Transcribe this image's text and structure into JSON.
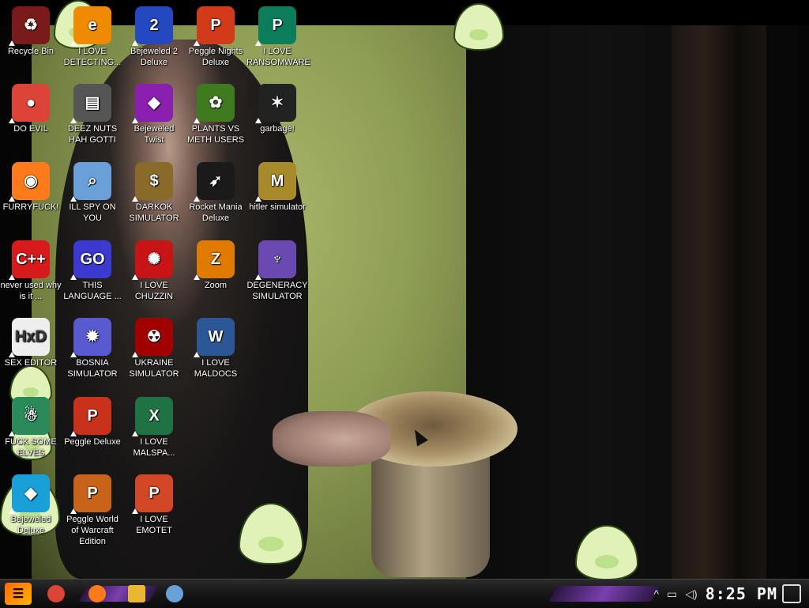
{
  "desktop": {
    "icons": [
      {
        "name": "recycle-bin-icon",
        "label": "Recycle Bin",
        "bg": "#7a1a1a",
        "glyph": "♻"
      },
      {
        "name": "i-love-detecting-icon",
        "label": "I LOVE DETECTING...",
        "bg": "#f08a00",
        "glyph": "e"
      },
      {
        "name": "bejeweled-2-deluxe-icon",
        "label": "Bejeweled 2 Deluxe",
        "bg": "#2448c0",
        "glyph": "2"
      },
      {
        "name": "peggle-nights-deluxe-icon",
        "label": "Peggle Nights Deluxe",
        "bg": "#d23a1a",
        "glyph": "P"
      },
      {
        "name": "i-love-ransomware-icon",
        "label": "I LOVE RANSOMWARE",
        "bg": "#0c7d5a",
        "glyph": "P"
      },
      {
        "name": "do-evil-icon",
        "label": "DO EVIL",
        "bg": "#db4437",
        "glyph": "●"
      },
      {
        "name": "deez-nuts-icon",
        "label": "DEEZ NUTS HAH GOTTI",
        "bg": "#555",
        "glyph": "▤"
      },
      {
        "name": "bejeweled-twist-icon",
        "label": "Bejeweled Twist",
        "bg": "#8a1fb0",
        "glyph": "◆"
      },
      {
        "name": "plants-vs-meth-users-icon",
        "label": "PLANTS VS METH USERS",
        "bg": "#3f7a1e",
        "glyph": "✿"
      },
      {
        "name": "garbage-icon",
        "label": "garbage!",
        "bg": "#222",
        "glyph": "✶"
      },
      {
        "name": "furryfuck-icon",
        "label": "FURRYFUCK!",
        "bg": "#ff7a1a",
        "glyph": "◉"
      },
      {
        "name": "ill-spy-on-you-icon",
        "label": "ILL SPY ON YOU",
        "bg": "#6aa0d8",
        "glyph": "⌕"
      },
      {
        "name": "darkok-simulator-icon",
        "label": "DARKOK SIMULATOR",
        "bg": "#8a6a2a",
        "glyph": "$"
      },
      {
        "name": "rocket-mania-deluxe-icon",
        "label": "Rocket Mania Deluxe",
        "bg": "#1a1a1a",
        "glyph": "➶"
      },
      {
        "name": "hitler-simulator-icon",
        "label": "hitler simulator",
        "bg": "#a88a2a",
        "glyph": "M"
      },
      {
        "name": "never-used-icon",
        "label": "never used why is it ...",
        "bg": "#d91a1a",
        "glyph": "C++"
      },
      {
        "name": "this-language-icon",
        "label": "THIS LANGUAGE ...",
        "bg": "#3a3ad0",
        "glyph": "GO"
      },
      {
        "name": "i-love-chuzzin-icon",
        "label": "I LOVE CHUZZIN",
        "bg": "#c81414",
        "glyph": "✺"
      },
      {
        "name": "zoom-icon",
        "label": "Zoom",
        "bg": "#e07a00",
        "glyph": "Z"
      },
      {
        "name": "degeneracy-simulator-icon",
        "label": "DEGENERACY SIMULATOR",
        "bg": "#6a4ab0",
        "glyph": "♆"
      },
      {
        "name": "sex-editor-icon",
        "label": "SEX EDITOR",
        "bg": "#eee",
        "glyph": "HxD"
      },
      {
        "name": "bosnia-simulator-icon",
        "label": "BOSNIA SIMULATOR",
        "bg": "#5a5ad0",
        "glyph": "✹"
      },
      {
        "name": "ukraine-simulator-icon",
        "label": "UKRAINE SIMULATOR",
        "bg": "#a00000",
        "glyph": "☢"
      },
      {
        "name": "i-love-maldocs-icon",
        "label": "I LOVE MALDOCS",
        "bg": "#2b5797",
        "glyph": "W"
      },
      {
        "name": "fuck-some-elves-icon",
        "label": "FUCK SOME ELVES",
        "bg": "#2a8a5a",
        "glyph": "☃"
      },
      {
        "name": "peggle-deluxe-icon",
        "label": "Peggle Deluxe",
        "bg": "#c8321a",
        "glyph": "P"
      },
      {
        "name": "i-love-malspa-icon",
        "label": "I LOVE MALSPA...",
        "bg": "#1f7244",
        "glyph": "X"
      },
      {
        "name": "bejeweled-deluxe-icon",
        "label": "Bejeweled Deluxe",
        "bg": "#1aa0d8",
        "glyph": "◆"
      },
      {
        "name": "peggle-world-of-warcraft-icon",
        "label": "Peggle World of Warcraft Edition",
        "bg": "#c8641a",
        "glyph": "P"
      },
      {
        "name": "i-love-emotet-icon",
        "label": "I LOVE EMOTET",
        "bg": "#d24726",
        "glyph": "P"
      }
    ]
  },
  "taskbar": {
    "clock": "8:25 PM",
    "apps": [
      {
        "name": "chrome-taskbar-icon",
        "color": "#db4437"
      },
      {
        "name": "firefox-taskbar-icon",
        "color": "#ff7a1a"
      },
      {
        "name": "file-explorer-taskbar-icon",
        "color": "#e8b830"
      },
      {
        "name": "paint-taskbar-icon",
        "color": "#6aa0d8"
      }
    ]
  },
  "colors": {
    "accent": "#7a3fb0",
    "peridot": "#e1f2b8"
  }
}
